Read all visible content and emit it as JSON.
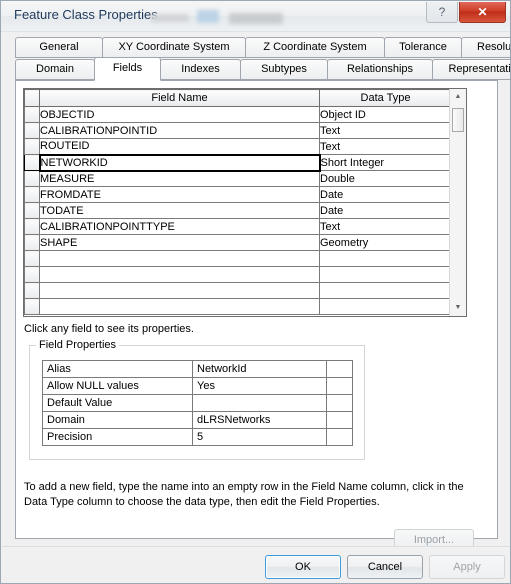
{
  "window": {
    "title": "Feature Class Properties",
    "help_label": "?",
    "close_label": "✕"
  },
  "tabs": {
    "row1": [
      {
        "label": "General",
        "active": false
      },
      {
        "label": "XY Coordinate System",
        "active": false
      },
      {
        "label": "Z Coordinate System",
        "active": false
      },
      {
        "label": "Tolerance",
        "active": false
      },
      {
        "label": "Resolution",
        "active": false
      }
    ],
    "row2": [
      {
        "label": "Domain",
        "active": false
      },
      {
        "label": "Fields",
        "active": true
      },
      {
        "label": "Indexes",
        "active": false
      },
      {
        "label": "Subtypes",
        "active": false
      },
      {
        "label": "Relationships",
        "active": false
      },
      {
        "label": "Representations",
        "active": false
      }
    ]
  },
  "grid": {
    "headers": {
      "field_name": "Field Name",
      "data_type": "Data Type"
    },
    "rows": [
      {
        "name": "OBJECTID",
        "type": "Object ID",
        "selected": false
      },
      {
        "name": "CALIBRATIONPOINTID",
        "type": "Text",
        "selected": false
      },
      {
        "name": "ROUTEID",
        "type": "Text",
        "selected": false
      },
      {
        "name": "NETWORKID",
        "type": "Short Integer",
        "selected": true
      },
      {
        "name": "MEASURE",
        "type": "Double",
        "selected": false
      },
      {
        "name": "FROMDATE",
        "type": "Date",
        "selected": false
      },
      {
        "name": "TODATE",
        "type": "Date",
        "selected": false
      },
      {
        "name": "CALIBRATIONPOINTTYPE",
        "type": "Text",
        "selected": false
      },
      {
        "name": "SHAPE",
        "type": "Geometry",
        "selected": false
      },
      {
        "name": "",
        "type": "",
        "selected": false
      },
      {
        "name": "",
        "type": "",
        "selected": false
      },
      {
        "name": "",
        "type": "",
        "selected": false
      },
      {
        "name": "",
        "type": "",
        "selected": false
      }
    ],
    "scroll_up": "▲",
    "scroll_down": "▼"
  },
  "hint": "Click any field to see its properties.",
  "field_properties": {
    "legend": "Field Properties",
    "rows": [
      {
        "label": "Alias",
        "value": "NetworkId"
      },
      {
        "label": "Allow NULL values",
        "value": "Yes"
      },
      {
        "label": "Default Value",
        "value": ""
      },
      {
        "label": "Domain",
        "value": "dLRSNetworks"
      },
      {
        "label": "Precision",
        "value": "5"
      }
    ]
  },
  "import_button": "Import...",
  "footnote": "To add a new field, type the name into an empty row in the Field Name column, click in the Data Type column to choose the data type, then edit the Field Properties.",
  "dialog_buttons": {
    "ok": "OK",
    "cancel": "Cancel",
    "apply": "Apply"
  }
}
